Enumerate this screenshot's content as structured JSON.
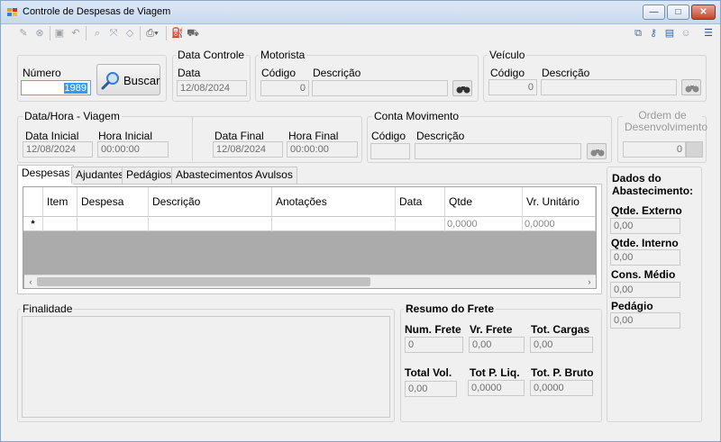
{
  "window": {
    "title": "Controle de Despesas de Viagem",
    "controls": {
      "minimize": "—",
      "maximize": "□",
      "close": "✕"
    }
  },
  "toolbar": {
    "icons": [
      "edit-icon",
      "cancel-icon",
      "save-icon",
      "undo-icon",
      "search-icon",
      "expand-icon",
      "erase-icon",
      "print-icon",
      "fuel-pump-icon",
      "truck-icon"
    ],
    "right_icons": [
      "cards-icon",
      "key-icon",
      "window-icon",
      "user-icon",
      "menu-icon"
    ]
  },
  "numero": {
    "label": "Número",
    "value": "1989",
    "button": "Buscar"
  },
  "data_controle": {
    "title": "Data Controle",
    "data_label": "Data",
    "data_value": "12/08/2024"
  },
  "motorista": {
    "title": "Motorista",
    "codigo_label": "Código",
    "codigo_value": "0",
    "descricao_label": "Descrição",
    "descricao_value": ""
  },
  "veiculo": {
    "title": "Veículo",
    "codigo_label": "Código",
    "codigo_value": "0",
    "descricao_label": "Descrição",
    "descricao_value": ""
  },
  "viagem": {
    "title": "Data/Hora - Viagem",
    "data_inicial_label": "Data Inicial",
    "data_inicial": "12/08/2024",
    "hora_inicial_label": "Hora Inicial",
    "hora_inicial": "00:00:00",
    "data_final_label": "Data Final",
    "data_final": "12/08/2024",
    "hora_final_label": "Hora Final",
    "hora_final": "00:00:00"
  },
  "conta_movimento": {
    "title": "Conta Movimento",
    "codigo_label": "Código",
    "codigo_value": "",
    "descricao_label": "Descrição",
    "descricao_value": ""
  },
  "ordem": {
    "title_line1": "Ordem de",
    "title_line2": "Desenvolvimento",
    "value": "0"
  },
  "tabs": [
    "Despesas",
    "Ajudantes",
    "Pedágios",
    "Abastecimentos Avulsos"
  ],
  "grid": {
    "columns": [
      "Item",
      "Despesa",
      "Descrição",
      "Anotações",
      "Data",
      "Qtde",
      "Vr. Unitário"
    ],
    "new_row_marker": "*",
    "new_row": [
      "",
      "",
      "",
      "",
      "",
      "0,0000",
      "0,0000"
    ]
  },
  "abastecimento": {
    "title_line1": "Dados do",
    "title_line2": "Abastecimento:",
    "externo_label": "Qtde. Externo",
    "externo": "0,00",
    "interno_label": "Qtde. Interno",
    "interno": "0,00",
    "consumo_label": "Cons. Médio",
    "consumo": "0,00",
    "pedagio_label": "Pedágio",
    "pedagio": "0,00"
  },
  "finalidade": {
    "title": "Finalidade",
    "value": ""
  },
  "frete": {
    "title": "Resumo do Frete",
    "num_label": "Num. Frete",
    "num": "0",
    "vr_label": "Vr. Frete",
    "vr": "0,00",
    "cargas_label": "Tot. Cargas",
    "cargas": "0,00",
    "vol_label": "Total Vol.",
    "vol": "0,00",
    "liq_label": "Tot P. Liq.",
    "liq": "0,0000",
    "bruto_label": "Tot. P. Bruto",
    "bruto": "0,0000"
  }
}
